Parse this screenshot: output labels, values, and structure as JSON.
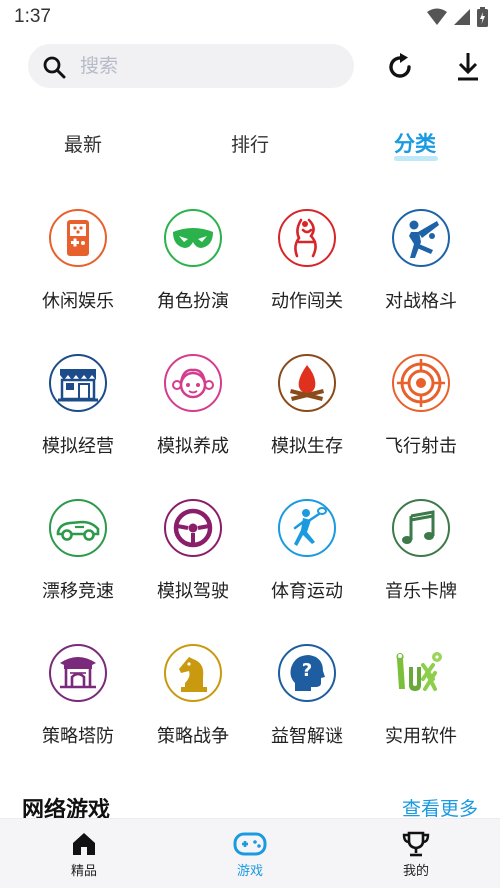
{
  "status": {
    "time": "1:37"
  },
  "search": {
    "placeholder": "搜索"
  },
  "tabs": [
    {
      "label": "最新",
      "active": false
    },
    {
      "label": "排行",
      "active": false
    },
    {
      "label": "分类",
      "active": true
    }
  ],
  "categories": [
    {
      "label": "休闲娱乐",
      "icon": "handheld-console-icon",
      "color": "#e8612c"
    },
    {
      "label": "角色扮演",
      "icon": "mask-icon",
      "color": "#2bb24c"
    },
    {
      "label": "动作闯关",
      "icon": "fighter-icon",
      "color": "#d7262a"
    },
    {
      "label": "对战格斗",
      "icon": "kick-fighter-icon",
      "color": "#1e63a8"
    },
    {
      "label": "模拟经营",
      "icon": "shop-icon",
      "color": "#1c4c8a"
    },
    {
      "label": "模拟养成",
      "icon": "girl-face-icon",
      "color": "#d43c8e"
    },
    {
      "label": "模拟生存",
      "icon": "campfire-icon",
      "color": "#8a4a1a"
    },
    {
      "label": "飞行射击",
      "icon": "target-icon",
      "color": "#e8612c"
    },
    {
      "label": "漂移竞速",
      "icon": "race-car-icon",
      "color": "#2c9a4a"
    },
    {
      "label": "模拟驾驶",
      "icon": "steering-wheel-icon",
      "color": "#8a1e6a"
    },
    {
      "label": "体育运动",
      "icon": "tennis-player-icon",
      "color": "#1a9ae0"
    },
    {
      "label": "音乐卡牌",
      "icon": "music-note-icon",
      "color": "#3c7a4a"
    },
    {
      "label": "策略塔防",
      "icon": "tower-icon",
      "color": "#7a2a7a"
    },
    {
      "label": "策略战争",
      "icon": "chess-knight-icon",
      "color": "#c99a10"
    },
    {
      "label": "益智解谜",
      "icon": "head-question-icon",
      "color": "#1e5ea0"
    },
    {
      "label": "实用软件",
      "icon": "tux-logo-icon",
      "color": "#7bbf3a"
    }
  ],
  "section": {
    "title": "网络游戏",
    "more": "查看更多"
  },
  "bottom_nav": [
    {
      "label": "精品",
      "icon": "home-icon",
      "active": false
    },
    {
      "label": "游戏",
      "icon": "gamepad-icon",
      "active": true
    },
    {
      "label": "我的",
      "icon": "trophy-icon",
      "active": false
    }
  ],
  "colors": {
    "accent": "#1a9ae0",
    "search_bg": "#f1f1f3",
    "nav_bg": "#f5f5f7"
  }
}
